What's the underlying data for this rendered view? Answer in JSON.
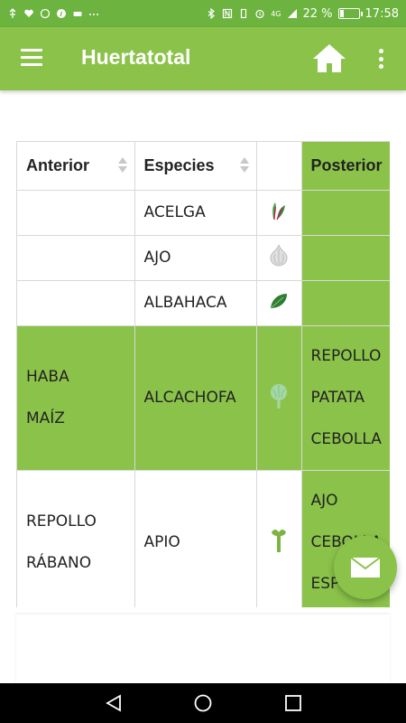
{
  "status_bar": {
    "icons_left": [
      "usb-icon",
      "heart-icon",
      "whatsapp-icon",
      "pinterest-icon",
      "car-icon",
      "more-dots-icon"
    ],
    "icons_right": [
      "bluetooth-icon",
      "nfc-icon",
      "vibrate-icon",
      "alarm-icon",
      "signal-icon"
    ],
    "network": "4G",
    "battery": "22 %",
    "battery_fraction": 0.22,
    "time": "17:58"
  },
  "app_bar": {
    "title": "Huertatotal",
    "menu_icon": "hamburger-icon",
    "home_icon": "home-icon",
    "overflow_icon": "more-vert-icon",
    "color": "#8bc34a"
  },
  "table": {
    "headers": [
      "Anterior",
      "Especies",
      "",
      "Posterior"
    ],
    "rows": [
      {
        "anterior": [],
        "especie": "ACELGA",
        "icon": "chard-icon",
        "posterior": []
      },
      {
        "anterior": [],
        "especie": "AJO",
        "icon": "garlic-icon",
        "posterior": []
      },
      {
        "anterior": [],
        "especie": "ALBAHACA",
        "icon": "basil-icon",
        "posterior": []
      },
      {
        "anterior": [
          "HABA",
          "MAÍZ"
        ],
        "especie": "ALCACHOFA",
        "icon": "artichoke-icon",
        "posterior": [
          "REPOLLO",
          "PATATA",
          "CEBOLLA"
        ]
      },
      {
        "anterior": [
          "REPOLLO",
          "RÁBANO"
        ],
        "especie": "APIO",
        "icon": "celery-icon",
        "posterior": [
          "AJO",
          "CEBOLLA",
          "ESP"
        ]
      }
    ],
    "highlight_color": "#8bc34a"
  },
  "fab": {
    "icon": "mail-icon"
  },
  "nav_bar": {
    "back_icon": "back-icon",
    "home_icon": "nav-home-icon",
    "recents_icon": "recents-icon"
  }
}
